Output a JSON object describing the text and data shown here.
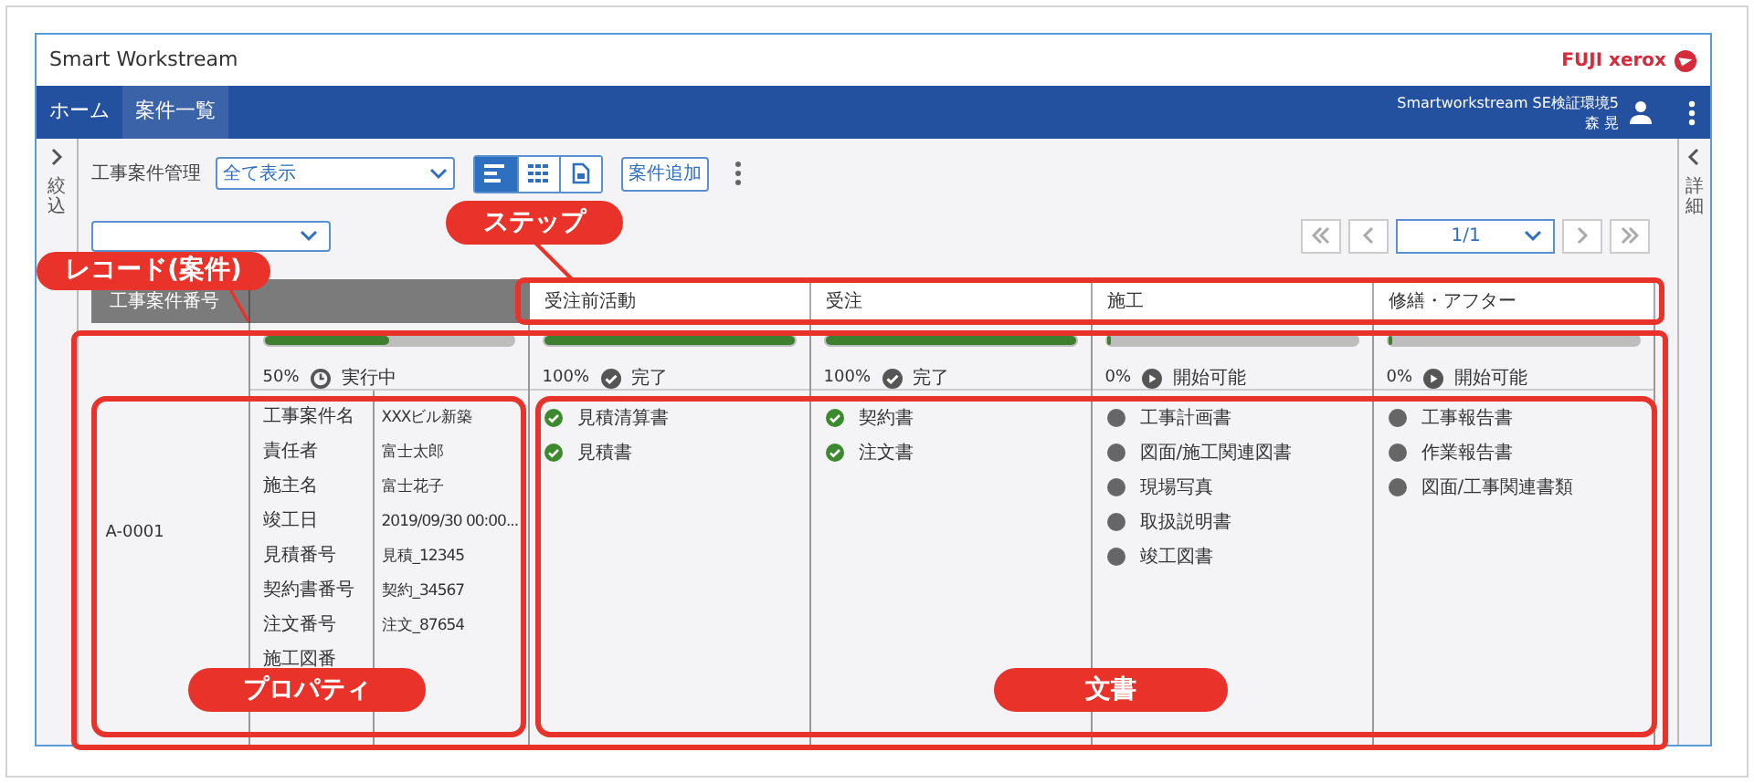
{
  "window": {
    "title": "Smart Workstream",
    "logo_text": "FUJI xerox"
  },
  "nav": {
    "tabs": [
      {
        "label": "ホーム",
        "selected": false
      },
      {
        "label": "案件一覧",
        "selected": true
      }
    ],
    "user_env": "Smartworkstream SE検証環境5",
    "user_name": "森 晃"
  },
  "left_panel": {
    "label": "絞込"
  },
  "right_panel": {
    "label": "詳細"
  },
  "toolbar": {
    "label": "工事案件管理",
    "view_select": "全て表示",
    "views": [
      {
        "kind": "list",
        "selected": true
      },
      {
        "kind": "grid",
        "selected": false
      },
      {
        "kind": "document",
        "selected": false
      }
    ],
    "add_button": "案件追加"
  },
  "pager": {
    "page": "1/1"
  },
  "table": {
    "columns": [
      "工事案件番号"
    ],
    "steps": [
      {
        "name": "受注前活動",
        "level": 1,
        "percent": "100%",
        "kind": "done",
        "status": "完了",
        "documents": [
          {
            "name": "見積清算書",
            "done": true
          },
          {
            "name": "見積書",
            "done": true
          }
        ]
      },
      {
        "name": "受注",
        "level": 1,
        "percent": "100%",
        "kind": "done",
        "status": "完了",
        "documents": [
          {
            "name": "契約書",
            "done": true
          },
          {
            "name": "注文書",
            "done": true
          }
        ]
      },
      {
        "name": "施工",
        "level": 0.01,
        "percent": "0%",
        "kind": "ready",
        "status": "開始可能",
        "documents": [
          {
            "name": "工事計画書",
            "done": false
          },
          {
            "name": "図面/施工関連図書",
            "done": false
          },
          {
            "name": "現場写真",
            "done": false
          },
          {
            "name": "取扱説明書",
            "done": false
          },
          {
            "name": "竣工図書",
            "done": false
          }
        ]
      },
      {
        "name": "修繕・アフター",
        "level": 0.01,
        "percent": "0%",
        "kind": "ready",
        "status": "開始可能",
        "documents": [
          {
            "name": "工事報告書",
            "done": false
          },
          {
            "name": "作業報告書",
            "done": false
          },
          {
            "name": "図面/工事関連書類",
            "done": false
          }
        ]
      }
    ],
    "record": {
      "id": "A-0001",
      "level": 0.5,
      "percent": "50%",
      "kind": "running",
      "status": "実行中",
      "properties": [
        {
          "label": "工事案件名",
          "value": "XXXビル新築"
        },
        {
          "label": "責任者",
          "value": "富士太郎"
        },
        {
          "label": "施主名",
          "value": "富士花子"
        },
        {
          "label": "竣工日",
          "value": "2019/09/30 00:00..."
        },
        {
          "label": "見積番号",
          "value": "見積_12345"
        },
        {
          "label": "契約書番号",
          "value": "契約_34567"
        },
        {
          "label": "注文番号",
          "value": "注文_87654"
        },
        {
          "label": "施工図番"
        }
      ]
    }
  },
  "annotations": [
    "ステップ",
    "レコード(案件)",
    "プロパティ",
    "文書"
  ]
}
